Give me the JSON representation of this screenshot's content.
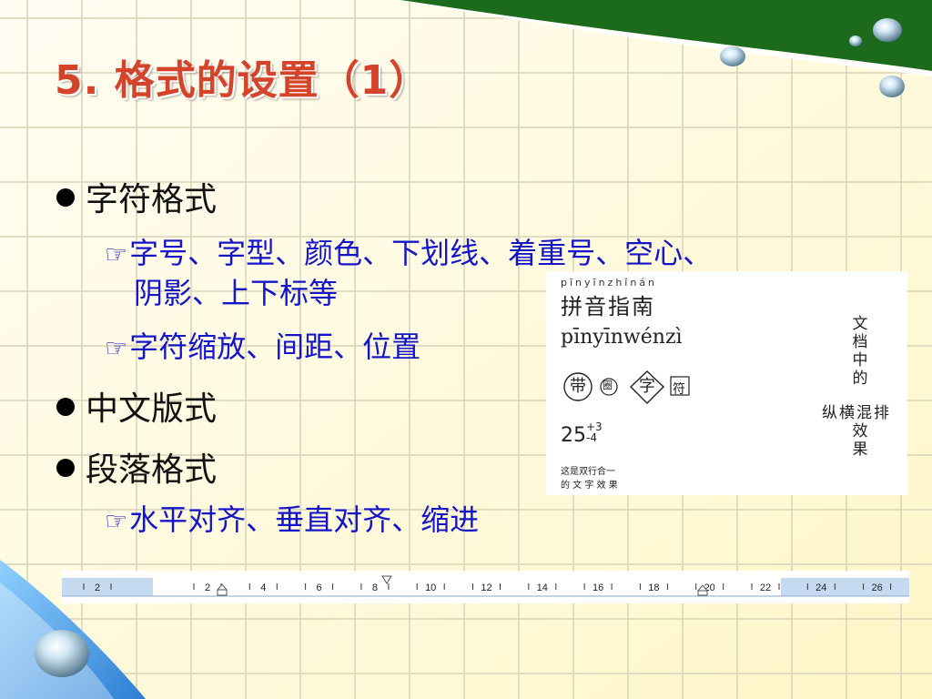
{
  "slide": {
    "title": "5. 格式的设置（1）",
    "bullets": [
      {
        "text": "字符格式"
      },
      {
        "text": "中文版式"
      },
      {
        "text": "段落格式"
      }
    ],
    "subs": [
      {
        "line1": "字号、字型、颜色、下划线、着重号、空心、",
        "line2": "阴影、上下标等"
      },
      {
        "line1": "字符缩放、间距、位置"
      },
      {
        "line1": "水平对齐、垂直对齐、缩进"
      }
    ],
    "sub_marker": "☞"
  },
  "sample": {
    "pinyin_small": "pīnyīnzhǐnán",
    "pinyin_hanzi": "拼音指南",
    "pinyin_line": "pīnyīnwénzì",
    "enclosed": [
      "带",
      "圈",
      "字",
      "符"
    ],
    "equation": {
      "base": "25",
      "sup": "+3",
      "sub": "-4"
    },
    "two_line": {
      "line1": "这是双行合一",
      "line2": "的 文 字 效 果"
    },
    "vertical_top": [
      "文",
      "档",
      "中",
      "的"
    ],
    "horizontal": "纵横混排",
    "vertical_bottom": [
      "效",
      "果"
    ]
  },
  "ruler": {
    "labels": [
      "2",
      "2",
      "4",
      "6",
      "8",
      "10",
      "12",
      "14",
      "16",
      "18",
      "20",
      "22",
      "24",
      "26"
    ]
  },
  "colors": {
    "title": "#d4442a",
    "subtext": "#1515c8",
    "grid": "#d9d3b8",
    "corner_green": "#1c6a1c",
    "corner_blue": "#4aa3e8"
  }
}
